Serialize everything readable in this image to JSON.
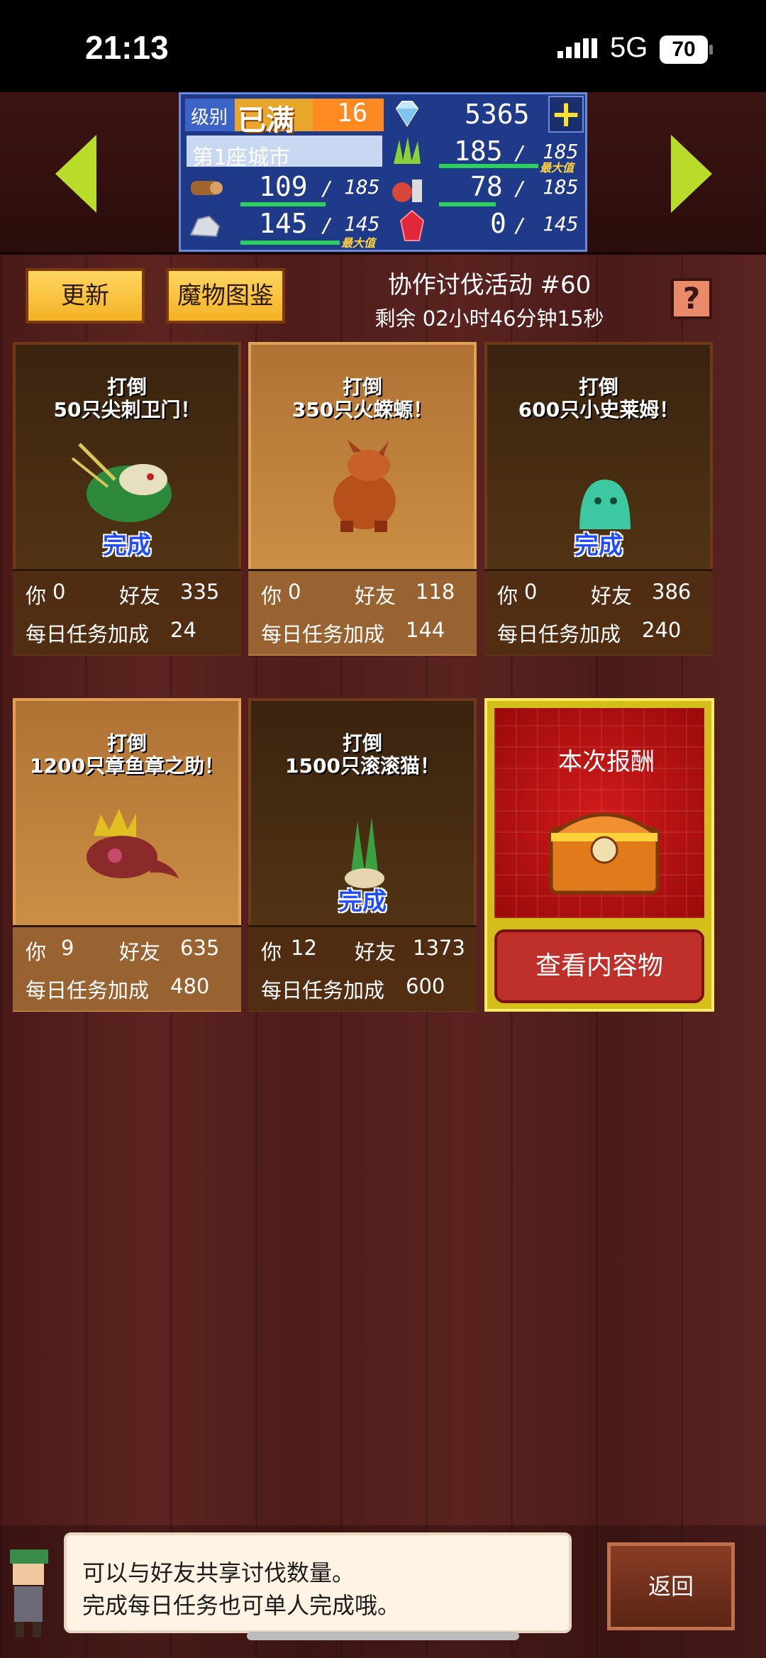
{
  "status": {
    "time": "21:13",
    "network": "5G",
    "battery": "70"
  },
  "stats": {
    "level_label": "级别",
    "level_max": "已满",
    "level": "16",
    "gems": "5365",
    "plus": "+",
    "city": "第1座城市",
    "wood": "109",
    "wood_max": "185",
    "grass": "185",
    "grass_max": "185",
    "grass_tag": "最大值",
    "food": "78",
    "food_max": "185",
    "stone": "145",
    "stone_max": "145",
    "stone_tag": "最大值",
    "ruby": "0",
    "ruby_max": "145"
  },
  "toolbar": {
    "refresh_label": "更新",
    "bestiary_label": "魔物图鉴",
    "event_title": "协作讨伐活动 #60",
    "remaining": "剩余 02小时46分钟15秒",
    "help": "?"
  },
  "cards": [
    {
      "line1": "打倒",
      "line2": "50只尖刺卫门！",
      "status": "完成",
      "you_label": "你",
      "you": "0",
      "friend_label": "好友",
      "friend": "335",
      "bonus_label": "每日任务加成",
      "bonus": "24",
      "style": "dark"
    },
    {
      "line1": "打倒",
      "line2": "350只火蝾螈！",
      "status": "",
      "you_label": "你",
      "you": "0",
      "friend_label": "好友",
      "friend": "118",
      "bonus_label": "每日任务加成",
      "bonus": "144",
      "style": "light"
    },
    {
      "line1": "打倒",
      "line2": "600只小史莱姆！",
      "status": "完成",
      "you_label": "你",
      "you": "0",
      "friend_label": "好友",
      "friend": "386",
      "bonus_label": "每日任务加成",
      "bonus": "240",
      "style": "dark"
    },
    {
      "line1": "打倒",
      "line2": "1200只章鱼章之助！",
      "status": "",
      "you_label": "你",
      "you": "9",
      "friend_label": "好友",
      "friend": "635",
      "bonus_label": "每日任务加成",
      "bonus": "480",
      "style": "light"
    },
    {
      "line1": "打倒",
      "line2": "1500只滚滚猫！",
      "status": "完成",
      "you_label": "你",
      "you": "12",
      "friend_label": "好友",
      "friend": "1373",
      "bonus_label": "每日任务加成",
      "bonus": "600",
      "style": "dark"
    }
  ],
  "reward": {
    "title": "本次报酬",
    "button": "查看内容物"
  },
  "tip": {
    "line1": "可以与好友共享讨伐数量。",
    "line2": "完成每日任务也可单人完成哦。"
  },
  "back_label": "返回",
  "icons": [
    "gem-icon",
    "grass-icon",
    "wood-icon",
    "food-icon",
    "stone-icon",
    "ruby-icon",
    "treasure-chest-icon"
  ],
  "colors": {
    "accent_green": "#b9dc2a",
    "panel_blue": "#203a8a",
    "done_blue": "#1f4cff",
    "reward_red": "#c0302a"
  }
}
